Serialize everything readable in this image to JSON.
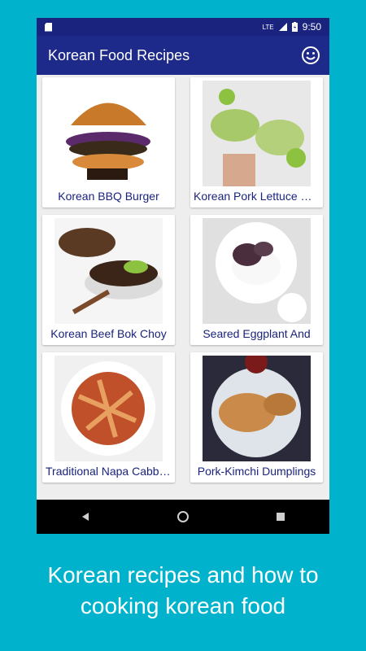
{
  "status": {
    "network": "LTE",
    "time": "9:50"
  },
  "appbar": {
    "title": "Korean Food Recipes",
    "icon": "smiley-icon"
  },
  "recipes": [
    {
      "label": "Korean BBQ Burger"
    },
    {
      "label": "Korean Pork Lettuce Wraps"
    },
    {
      "label": "Korean Beef Bok Choy"
    },
    {
      "label": "Seared Eggplant And"
    },
    {
      "label": "Traditional Napa Cabbage"
    },
    {
      "label": "Pork-Kimchi Dumplings"
    }
  ],
  "caption": {
    "line1": "Korean recipes and how to",
    "line2": "cooking korean food"
  },
  "colors": {
    "background": "#00b2cc",
    "appbar": "#1e2a8a",
    "statusbar": "#1a237e",
    "text_accent": "#1a237e"
  }
}
